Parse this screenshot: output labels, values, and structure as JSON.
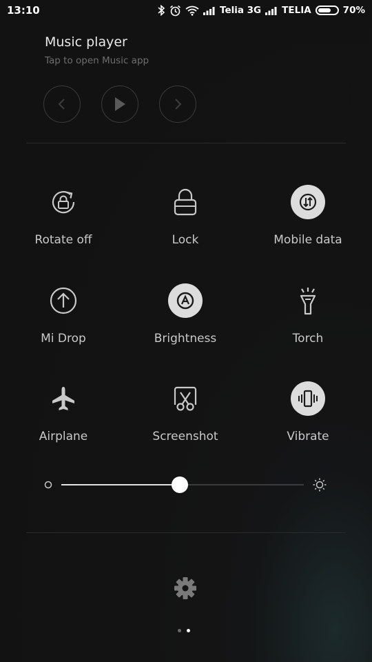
{
  "status_bar": {
    "time": "13:10",
    "carrier1": "Telia 3G",
    "carrier2": "TELIA",
    "battery": "70%",
    "battery_level": 0.7,
    "icons": [
      "bluetooth-icon",
      "alarm-icon",
      "wifi-icon",
      "signal-icon",
      "signal-icon",
      "battery-icon"
    ]
  },
  "music": {
    "title": "Music player",
    "subtitle": "Tap to open Music app",
    "controls": [
      "previous-icon",
      "play-icon",
      "next-icon"
    ]
  },
  "tiles": [
    {
      "label": "Rotate off",
      "icon": "rotate-lock-icon",
      "active": false
    },
    {
      "label": "Lock",
      "icon": "lock-icon",
      "active": false
    },
    {
      "label": "Mobile data",
      "icon": "mobile-data-icon",
      "active": true
    },
    {
      "label": "Mi Drop",
      "icon": "upload-icon",
      "active": false
    },
    {
      "label": "Brightness",
      "icon": "brightness-auto-icon",
      "active": true
    },
    {
      "label": "Torch",
      "icon": "torch-icon",
      "active": false
    },
    {
      "label": "Airplane",
      "icon": "airplane-icon",
      "active": false
    },
    {
      "label": "Screenshot",
      "icon": "screenshot-icon",
      "active": false
    },
    {
      "label": "Vibrate",
      "icon": "vibrate-icon",
      "active": true
    }
  ],
  "brightness": {
    "level": 0.49,
    "min_icon": "brightness-low-icon",
    "max_icon": "brightness-high-icon"
  },
  "settings_icon": "gear-icon",
  "pager": {
    "count": 2,
    "current": 2
  },
  "colors": {
    "background": "#121212",
    "active_tile": "#dcdcdc",
    "label": "#c9c9c9",
    "divider": "#2b2b2b"
  }
}
